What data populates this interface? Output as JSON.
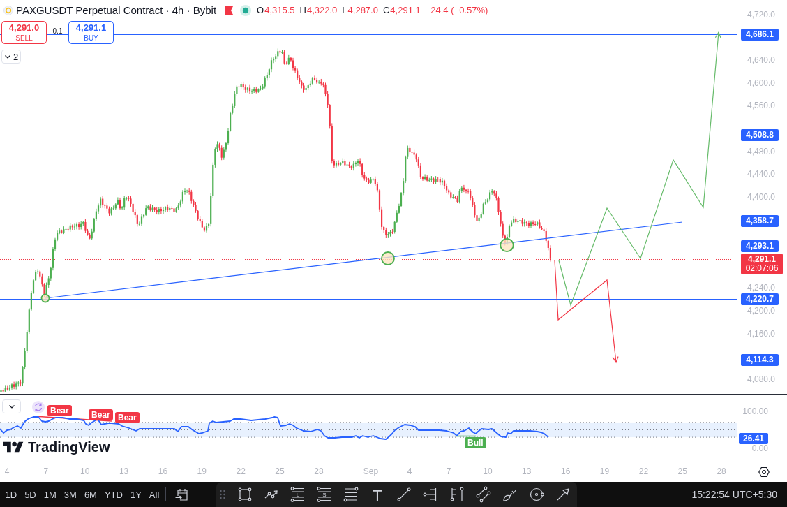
{
  "header": {
    "symbol": "PAXGUSDT Perpetual Contract · 4h · Bybit",
    "ohlc": [
      {
        "key": "O",
        "value": "4,315.5"
      },
      {
        "key": "H",
        "value": "4,322.0"
      },
      {
        "key": "L",
        "value": "4,287.0"
      },
      {
        "key": "C",
        "value": "4,291.1"
      }
    ],
    "change": "−24.4 (−0.57%)"
  },
  "order_panel": {
    "sell": {
      "price": "4,291.0",
      "label": "SELL"
    },
    "quantity": "0.1",
    "buy": {
      "price": "4,291.1",
      "label": "BUY"
    }
  },
  "indicators_toggle": {
    "count": "2"
  },
  "price_axis": {
    "ticks": [
      "4,720.0",
      "4,640.0",
      "4,600.0",
      "4,560.0",
      "4,480.0",
      "4,440.0",
      "4,400.0",
      "4,240.0",
      "4,200.0",
      "4,160.0",
      "4,080.0"
    ],
    "levels": [
      "4,686.1",
      "4,508.8",
      "4,358.7",
      "4,293.1",
      "4,220.7",
      "4,114.3"
    ],
    "last_price": {
      "price": "4,291.1",
      "countdown": "02:07:06"
    }
  },
  "rsi_pane": {
    "ticks": [
      "100.00",
      "0.00"
    ],
    "value": "26.41",
    "signals": [
      {
        "kind": "bear",
        "text": "Bear"
      },
      {
        "kind": "bear",
        "text": "Bear"
      },
      {
        "kind": "bear",
        "text": "Bear"
      },
      {
        "kind": "bull",
        "text": "Bull"
      }
    ]
  },
  "branding": {
    "name": "TradingView"
  },
  "time_axis": [
    {
      "kind": "day",
      "label": "4"
    },
    {
      "kind": "day",
      "label": "7"
    },
    {
      "kind": "day",
      "label": "10"
    },
    {
      "kind": "day",
      "label": "13"
    },
    {
      "kind": "day",
      "label": "16"
    },
    {
      "kind": "day",
      "label": "19"
    },
    {
      "kind": "day",
      "label": "22"
    },
    {
      "kind": "day",
      "label": "25"
    },
    {
      "kind": "day",
      "label": "28"
    },
    {
      "kind": "month",
      "label": "Sep"
    },
    {
      "kind": "day",
      "label": "4"
    },
    {
      "kind": "day",
      "label": "7"
    },
    {
      "kind": "day",
      "label": "10"
    },
    {
      "kind": "day",
      "label": "13"
    },
    {
      "kind": "day",
      "label": "16"
    },
    {
      "kind": "day",
      "label": "19"
    },
    {
      "kind": "day",
      "label": "22"
    },
    {
      "kind": "day",
      "label": "25"
    },
    {
      "kind": "day",
      "label": "28"
    }
  ],
  "bottom_toolbar": {
    "ranges": [
      "1D",
      "5D",
      "1M",
      "3M",
      "6M",
      "YTD",
      "1Y",
      "All"
    ],
    "drawing_tools": [
      {
        "kind": "rectangle"
      },
      {
        "kind": "polyline"
      },
      {
        "kind": "long-position",
        "glyph": "L"
      },
      {
        "kind": "short-position",
        "glyph": "S"
      },
      {
        "kind": "horizontal-lines"
      },
      {
        "kind": "text",
        "glyph": "T"
      },
      {
        "kind": "trend-line"
      },
      {
        "kind": "fib"
      },
      {
        "kind": "bars-pattern"
      },
      {
        "kind": "parallel-lines"
      },
      {
        "kind": "brush"
      },
      {
        "kind": "circle"
      },
      {
        "kind": "arrow"
      }
    ],
    "clock": "15:22:54 UTC+5:30"
  }
}
